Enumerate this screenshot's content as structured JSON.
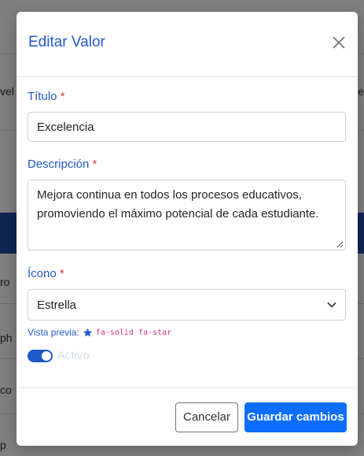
{
  "background": {
    "row1_left": "vel",
    "row1_right": "re",
    "row2_left": "ro",
    "row3_left": "ph",
    "row4_left": "co",
    "row5_left": "p"
  },
  "modal": {
    "title": "Editar Valor",
    "close_label": "×",
    "title_field": {
      "label": "Título",
      "required_mark": "*",
      "value": "Excelencia"
    },
    "description_field": {
      "label": "Descripción",
      "required_mark": "*",
      "value": "Mejora continua en todos los procesos educativos, promoviendo el máximo potencial de cada estudiante."
    },
    "icon_field": {
      "label": "Ícono",
      "required_mark": "*",
      "selected": "Estrella",
      "chevron": "⌄"
    },
    "preview": {
      "label": "Vista previa:",
      "icon_name": "star-icon",
      "code": "fa-solid fa-star"
    },
    "active_switch": {
      "label": "Activo",
      "checked": true
    },
    "footer": {
      "cancel_label": "Cancelar",
      "save_label": "Guardar cambios"
    }
  },
  "colors": {
    "accent": "#2159c8",
    "primary_button": "#0d6efd",
    "required": "#dc3545",
    "code": "#d63384"
  }
}
